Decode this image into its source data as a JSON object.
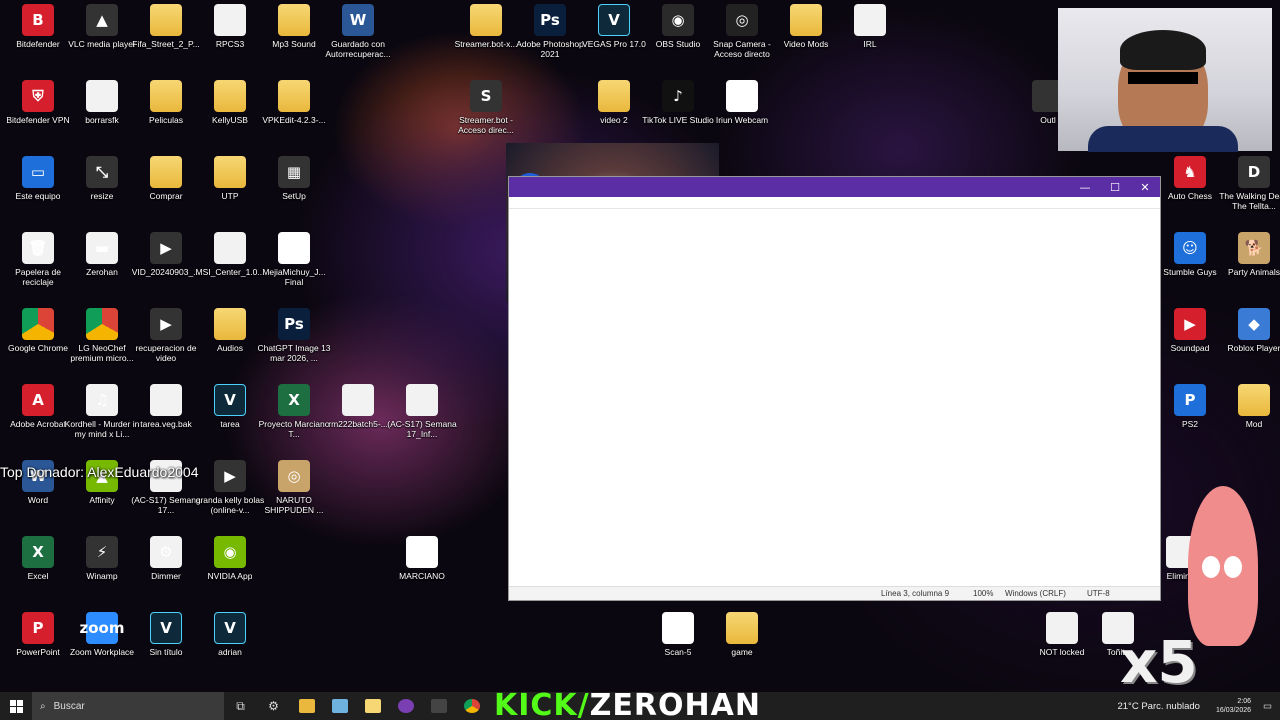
{
  "desktop_icons": [
    {
      "label": "Bitdefender",
      "icon": "bitdefender-icon",
      "glyph": "B",
      "style": "g-red"
    },
    {
      "label": "VLC media player",
      "icon": "vlc-icon",
      "glyph": "▲",
      "style": "g-dark"
    },
    {
      "label": "Fifa_Street_2_P...",
      "icon": "folder-icon",
      "glyph": "",
      "style": "g-folder"
    },
    {
      "label": "RPCS3",
      "icon": "file-icon",
      "glyph": "",
      "style": "g-file"
    },
    {
      "label": "Mp3 Sound",
      "icon": "folder-icon",
      "glyph": "",
      "style": "g-folder"
    },
    {
      "label": "Guardado con Autorrecuperac...",
      "icon": "word-icon",
      "glyph": "W",
      "style": "g-word"
    },
    {
      "label": "Streamer.bot-x...",
      "icon": "folder-icon",
      "glyph": "",
      "style": "g-folder"
    },
    {
      "label": "Adobe Photoshop 2021",
      "icon": "photoshop-icon",
      "glyph": "Ps",
      "style": "g-ps"
    },
    {
      "label": "VEGAS Pro 17.0",
      "icon": "vegas-icon",
      "glyph": "V",
      "style": "g-vegas"
    },
    {
      "label": "OBS Studio",
      "icon": "obs-icon",
      "glyph": "◉",
      "style": "g-obs"
    },
    {
      "label": "Snap Camera - Acceso directo",
      "icon": "snap-camera-icon",
      "glyph": "◎",
      "style": "g-snap"
    },
    {
      "label": "Video Mods",
      "icon": "folder-icon",
      "glyph": "",
      "style": "g-folder"
    },
    {
      "label": "IRL",
      "icon": "file-icon",
      "glyph": "",
      "style": "g-file"
    },
    {
      "label": "Bitdefender VPN",
      "icon": "bitdefender-vpn-icon",
      "glyph": "⛨",
      "style": "g-red"
    },
    {
      "label": "borrarsfk",
      "icon": "file-icon",
      "glyph": "",
      "style": "g-file"
    },
    {
      "label": "Peliculas",
      "icon": "folder-icon",
      "glyph": "",
      "style": "g-folder"
    },
    {
      "label": "KellyUSB",
      "icon": "folder-icon",
      "glyph": "",
      "style": "g-folder"
    },
    {
      "label": "VPKEdit-4.2.3-...",
      "icon": "folder-icon",
      "glyph": "",
      "style": "g-folder"
    },
    {
      "label": "Streamer.bot - Acceso direc...",
      "icon": "streamerbot-icon",
      "glyph": "S",
      "style": "g-dark"
    },
    {
      "label": "video 2",
      "icon": "folder-icon",
      "glyph": "",
      "style": "g-folder"
    },
    {
      "label": "TikTok LIVE Studio",
      "icon": "tiktok-icon",
      "glyph": "♪",
      "style": "g-tiktok"
    },
    {
      "label": "Iriun Webcam",
      "icon": "webcam-icon",
      "glyph": "◎",
      "style": "g-webcam"
    },
    {
      "label": "Outl",
      "icon": "shortcut-icon",
      "glyph": "",
      "style": "g-dark"
    },
    {
      "label": "Este equipo",
      "icon": "computer-icon",
      "glyph": "▭",
      "style": "g-blue"
    },
    {
      "label": "resize",
      "icon": "resize-icon",
      "glyph": "⤡",
      "style": "g-dark"
    },
    {
      "label": "Comprar",
      "icon": "folder-icon",
      "glyph": "",
      "style": "g-folder"
    },
    {
      "label": "UTP",
      "icon": "folder-icon",
      "glyph": "",
      "style": "g-folder"
    },
    {
      "label": "SetUp",
      "icon": "setup-icon",
      "glyph": "▦",
      "style": "g-dark"
    },
    {
      "label": "Auto Chess",
      "icon": "auto-chess-icon",
      "glyph": "♞",
      "style": "g-red"
    },
    {
      "label": "The Walking Dead The Tellta...",
      "icon": "walking-dead-icon",
      "glyph": "D",
      "style": "g-dark"
    },
    {
      "label": "Papelera de reciclaje",
      "icon": "recycle-bin-icon",
      "glyph": "🗑",
      "style": "g-file"
    },
    {
      "label": "Zerohan",
      "icon": "drive-icon",
      "glyph": "▬",
      "style": "g-file"
    },
    {
      "label": "VID_20240903_...",
      "icon": "video-file-icon",
      "glyph": "▶",
      "style": "g-dark"
    },
    {
      "label": "MSI_Center_1.0...",
      "icon": "file-icon",
      "glyph": "",
      "style": "g-file"
    },
    {
      "label": "MejiaMichuy_J... Final",
      "icon": "pdf-icon",
      "glyph": "PDF",
      "style": "g-pdf"
    },
    {
      "label": "Stumble Guys",
      "icon": "stumble-guys-icon",
      "glyph": "☺",
      "style": "g-blue"
    },
    {
      "label": "Party Animals",
      "icon": "party-animals-icon",
      "glyph": "🐕",
      "style": "g-patch"
    },
    {
      "label": "Google Chrome",
      "icon": "chrome-icon",
      "glyph": "",
      "style": "g-chrome"
    },
    {
      "label": "LG NeoChef premium micro...",
      "icon": "chrome-doc-icon",
      "glyph": "",
      "style": "g-chrome"
    },
    {
      "label": "recuperacion de video",
      "icon": "video-file-icon",
      "glyph": "▶",
      "style": "g-dark"
    },
    {
      "label": "Audios",
      "icon": "folder-icon",
      "glyph": "",
      "style": "g-folder"
    },
    {
      "label": "ChatGPT Image 13 mar 2026, ...",
      "icon": "psd-icon",
      "glyph": "Ps",
      "style": "g-ps"
    },
    {
      "label": "Soundpad",
      "icon": "soundpad-icon",
      "glyph": "▶",
      "style": "g-red"
    },
    {
      "label": "Roblox Player",
      "icon": "roblox-icon",
      "glyph": "◆",
      "style": "g-roblox"
    },
    {
      "label": "Adobe Acrobat",
      "icon": "acrobat-icon",
      "glyph": "A",
      "style": "g-red"
    },
    {
      "label": "Kordhell - Murder in my mind x Li...",
      "icon": "audio-file-icon",
      "glyph": "♫",
      "style": "g-file"
    },
    {
      "label": "tarea.veg.bak",
      "icon": "file-icon",
      "glyph": "",
      "style": "g-file"
    },
    {
      "label": "tarea",
      "icon": "vegas-project-icon",
      "glyph": "V",
      "style": "g-vegas"
    },
    {
      "label": "Proyecto Marciano T...",
      "icon": "excel-icon",
      "glyph": "X",
      "style": "g-excel"
    },
    {
      "label": "rm222batch5-...",
      "icon": "image-file-icon",
      "glyph": "",
      "style": "g-file"
    },
    {
      "label": "(AC-S17) Semana 17_Inf...",
      "icon": "document-icon",
      "glyph": "",
      "style": "g-file"
    },
    {
      "label": "PS2",
      "icon": "ps2-icon",
      "glyph": "P",
      "style": "g-blue"
    },
    {
      "label": "Mod",
      "icon": "folder-icon",
      "glyph": "",
      "style": "g-folder"
    },
    {
      "label": "Word",
      "icon": "word-icon",
      "glyph": "W",
      "style": "g-word"
    },
    {
      "label": "Affinity",
      "icon": "affinity-icon",
      "glyph": "▲",
      "style": "g-green"
    },
    {
      "label": "(AC-S17) Semana 17...",
      "icon": "file-icon",
      "glyph": "",
      "style": "g-file"
    },
    {
      "label": "granda kelly bolas (online-v...",
      "icon": "video-file-icon",
      "glyph": "▶",
      "style": "g-dark"
    },
    {
      "label": "NARUTO SHIPPUDEN ...",
      "icon": "naruto-icon",
      "glyph": "◎",
      "style": "g-patch"
    },
    {
      "label": "Excel",
      "icon": "excel-icon",
      "glyph": "X",
      "style": "g-excel"
    },
    {
      "label": "Winamp",
      "icon": "winamp-icon",
      "glyph": "⚡",
      "style": "g-dark"
    },
    {
      "label": "Dimmer",
      "icon": "dimmer-icon",
      "glyph": "⚙",
      "style": "g-file"
    },
    {
      "label": "NVIDIA App",
      "icon": "nvidia-icon",
      "glyph": "◉",
      "style": "g-green"
    },
    {
      "label": "MARCIANO",
      "icon": "pdf-icon",
      "glyph": "PDF",
      "style": "g-pdf"
    },
    {
      "label": "Eliminar",
      "icon": "file-icon",
      "glyph": "",
      "style": "g-file"
    },
    {
      "label": "PowerPoint",
      "icon": "powerpoint-icon",
      "glyph": "P",
      "style": "g-red"
    },
    {
      "label": "Zoom Workplace",
      "icon": "zoom-icon",
      "glyph": "zoom",
      "style": "g-zoom"
    },
    {
      "label": "Sin título",
      "icon": "vegas-project-icon",
      "glyph": "V",
      "style": "g-vegas"
    },
    {
      "label": "adrian",
      "icon": "vegas-project-icon",
      "glyph": "V",
      "style": "g-vegas"
    },
    {
      "label": "Scan-5",
      "icon": "pdf-icon",
      "glyph": "PDF",
      "style": "g-pdf"
    },
    {
      "label": "game",
      "icon": "folder-icon",
      "glyph": "",
      "style": "g-folder"
    },
    {
      "label": "NOT locked",
      "icon": "file-icon",
      "glyph": "",
      "style": "g-file"
    },
    {
      "label": "Toñito",
      "icon": "file-icon",
      "glyph": "",
      "style": "g-file"
    }
  ],
  "notepad": {
    "minimize": "—",
    "maximize": "☐",
    "close": "✕",
    "status_position": "Línea 3, columna 9",
    "status_zoom": "100%",
    "status_eol": "Windows (CRLF)",
    "status_encoding": "UTF-8"
  },
  "overlay": {
    "top_donador": "Top Donador: AlexEduardo2004",
    "multiplier": "x5"
  },
  "taskbar": {
    "search_placeholder": "Buscar",
    "kick_prefix": "KICK/",
    "kick_channel": "ZEROHAN",
    "weather": "21°C  Parc. nublado",
    "time": "2:06",
    "date": "16/03/2026"
  }
}
